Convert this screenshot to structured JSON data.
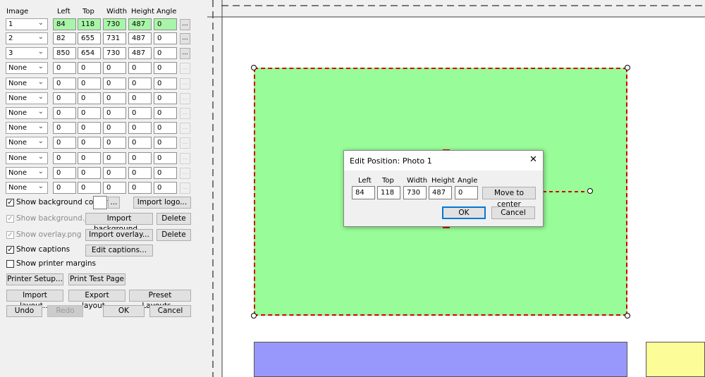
{
  "panel": {
    "headers": {
      "image": "Image",
      "left": "Left",
      "top": "Top",
      "width": "Width",
      "height": "Height",
      "angle": "Angle"
    },
    "rows": [
      {
        "image": "1",
        "left": "84",
        "top": "118",
        "width": "730",
        "height": "487",
        "angle": "0",
        "more": "..."
      },
      {
        "image": "2",
        "left": "82",
        "top": "655",
        "width": "731",
        "height": "487",
        "angle": "0",
        "more": "..."
      },
      {
        "image": "3",
        "left": "850",
        "top": "654",
        "width": "730",
        "height": "487",
        "angle": "0",
        "more": "..."
      },
      {
        "image": "None",
        "left": "0",
        "top": "0",
        "width": "0",
        "height": "0",
        "angle": "0",
        "more": "..."
      },
      {
        "image": "None",
        "left": "0",
        "top": "0",
        "width": "0",
        "height": "0",
        "angle": "0",
        "more": "..."
      },
      {
        "image": "None",
        "left": "0",
        "top": "0",
        "width": "0",
        "height": "0",
        "angle": "0",
        "more": "..."
      },
      {
        "image": "None",
        "left": "0",
        "top": "0",
        "width": "0",
        "height": "0",
        "angle": "0",
        "more": "..."
      },
      {
        "image": "None",
        "left": "0",
        "top": "0",
        "width": "0",
        "height": "0",
        "angle": "0",
        "more": "..."
      },
      {
        "image": "None",
        "left": "0",
        "top": "0",
        "width": "0",
        "height": "0",
        "angle": "0",
        "more": "..."
      },
      {
        "image": "None",
        "left": "0",
        "top": "0",
        "width": "0",
        "height": "0",
        "angle": "0",
        "more": "..."
      },
      {
        "image": "None",
        "left": "0",
        "top": "0",
        "width": "0",
        "height": "0",
        "angle": "0",
        "more": "..."
      },
      {
        "image": "None",
        "left": "0",
        "top": "0",
        "width": "0",
        "height": "0",
        "angle": "0",
        "more": "..."
      }
    ],
    "active_row_color": "#a8f5a8",
    "show_background_colour": {
      "label": "Show background colour",
      "checked": true,
      "swatch_color": "#ffffff",
      "more": "...",
      "import_logo": "Import logo..."
    },
    "show_background_jpg": {
      "label": "Show background.jpg",
      "checked": true,
      "disabled": true,
      "import": "Import background...",
      "delete": "Delete"
    },
    "show_overlay_png": {
      "label": "Show overlay.png",
      "checked": true,
      "disabled": true,
      "import": "Import overlay...",
      "delete": "Delete"
    },
    "show_captions": {
      "label": "Show captions",
      "checked": true,
      "edit": "Edit captions..."
    },
    "show_printer_margins": {
      "label": "Show printer margins",
      "checked": false
    },
    "buttons": {
      "printer_setup": "Printer Setup...",
      "print_test_page": "Print Test Page",
      "import_layout": "Import layout...",
      "export_layout": "Export layout...",
      "preset_layouts": "Preset Layouts...",
      "undo": "Undo",
      "redo": "Redo",
      "ok": "OK",
      "cancel": "Cancel"
    }
  },
  "canvas": {
    "photo_colors": {
      "photo1": "#98fc98",
      "photo2": "#9898fc",
      "photo3": "#fcfc98",
      "selection": "#d40000"
    }
  },
  "dialog": {
    "title": "Edit Position: Photo 1",
    "close": "✕",
    "labels": {
      "left": "Left",
      "top": "Top",
      "width": "Width",
      "height": "Height",
      "angle": "Angle"
    },
    "values": {
      "left": "84",
      "top": "118",
      "width": "730",
      "height": "487",
      "angle": "0"
    },
    "move_to_center": "Move to center",
    "ok": "OK",
    "cancel": "Cancel"
  }
}
